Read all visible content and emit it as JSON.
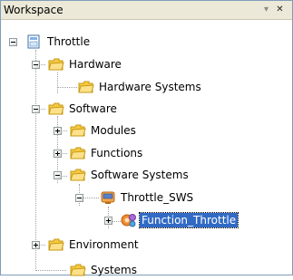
{
  "panel": {
    "title": "Workspace"
  },
  "tree": {
    "root": "Throttle",
    "hardware": "Hardware",
    "hardware_systems": "Hardware Systems",
    "software": "Software",
    "modules": "Modules",
    "functions": "Functions",
    "software_systems": "Software Systems",
    "throttle_sws": "Throttle_SWS",
    "function_throttle": "Function_Throttle",
    "environment": "Environment",
    "systems": "Systems"
  }
}
